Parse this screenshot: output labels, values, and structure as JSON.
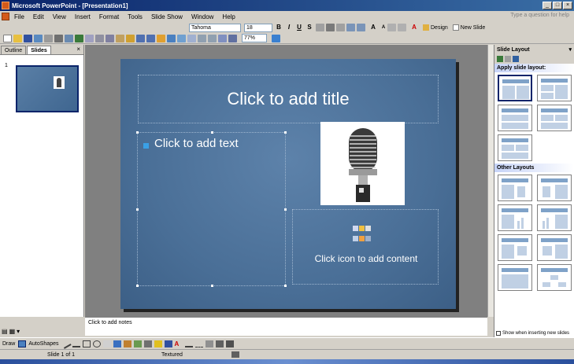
{
  "window": {
    "title": "Microsoft PowerPoint - [Presentation1]",
    "controls": [
      "_",
      "□",
      "×"
    ]
  },
  "menubar": {
    "items": [
      "File",
      "Edit",
      "View",
      "Insert",
      "Format",
      "Tools",
      "Slide Show",
      "Window",
      "Help"
    ],
    "question_box": "Type a question for help"
  },
  "toolbar": {
    "font": "Tahoma",
    "font_size": "18",
    "bold": "B",
    "italic": "I",
    "underline": "U",
    "shadow": "S",
    "font_color": "A",
    "design_label": "Design",
    "new_slide_label": "New Slide",
    "zoom": "77%"
  },
  "left_pane": {
    "tabs": [
      "Outline",
      "Slides"
    ],
    "active_tab": "Slides",
    "close": "×",
    "slide_number": "1"
  },
  "slide": {
    "title_placeholder": "Click to add title",
    "text_placeholder": "Click to add text",
    "content_placeholder": "Click icon to add content",
    "image": "microphone-image"
  },
  "notes": {
    "placeholder": "Click to add notes"
  },
  "task_pane": {
    "title": "Slide Layout",
    "section_apply": "Apply slide layout:",
    "section_other": "Other Layouts",
    "checkbox_label": "Show when inserting new slides",
    "checkbox_checked": true
  },
  "drawing_toolbar": {
    "draw_label": "Draw",
    "autoshapes_label": "AutoShapes"
  },
  "status_bar": {
    "slide_position": "Slide 1 of 1",
    "design_name": "Textured"
  },
  "colors": {
    "accent": "#0a246a",
    "slide_bg": "#4a6f97",
    "bullet": "#3aa0e6"
  }
}
